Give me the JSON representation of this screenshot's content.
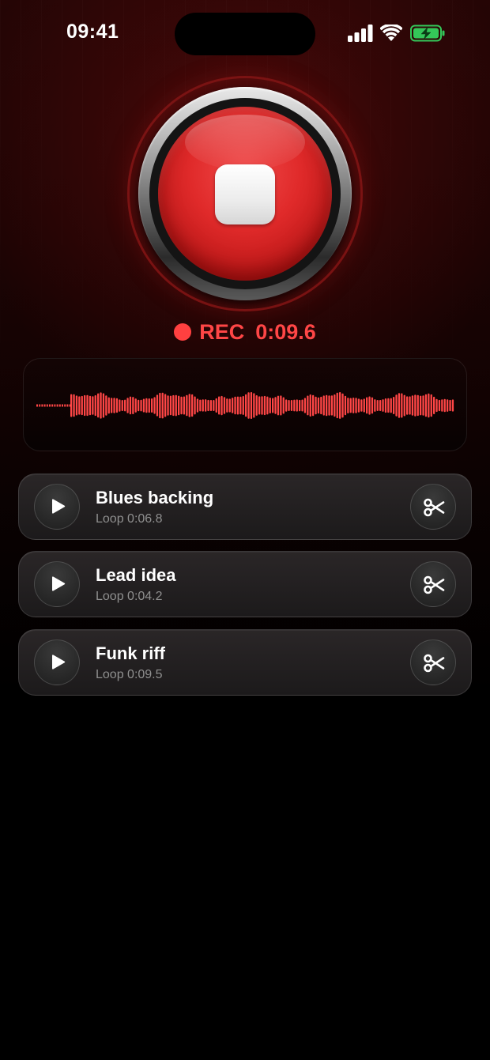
{
  "status_bar": {
    "time": "09:41",
    "icons": [
      "signal-icon",
      "wifi-icon",
      "battery-charging-icon"
    ],
    "battery_color": "#34c759"
  },
  "recorder": {
    "state_label": "REC",
    "elapsed": "0:09.6",
    "accent_color": "#ff4646",
    "button_icon": "stop-icon"
  },
  "waveform": {
    "color": "#ff4646"
  },
  "loops": [
    {
      "title": "Blues backing",
      "subtitle": "Loop 0:06.8",
      "play_icon": "play-icon",
      "action_icon": "scissors-icon"
    },
    {
      "title": "Lead idea",
      "subtitle": "Loop 0:04.2",
      "play_icon": "play-icon",
      "action_icon": "scissors-icon"
    },
    {
      "title": "Funk riff",
      "subtitle": "Loop 0:09.5",
      "play_icon": "play-icon",
      "action_icon": "scissors-icon"
    }
  ]
}
